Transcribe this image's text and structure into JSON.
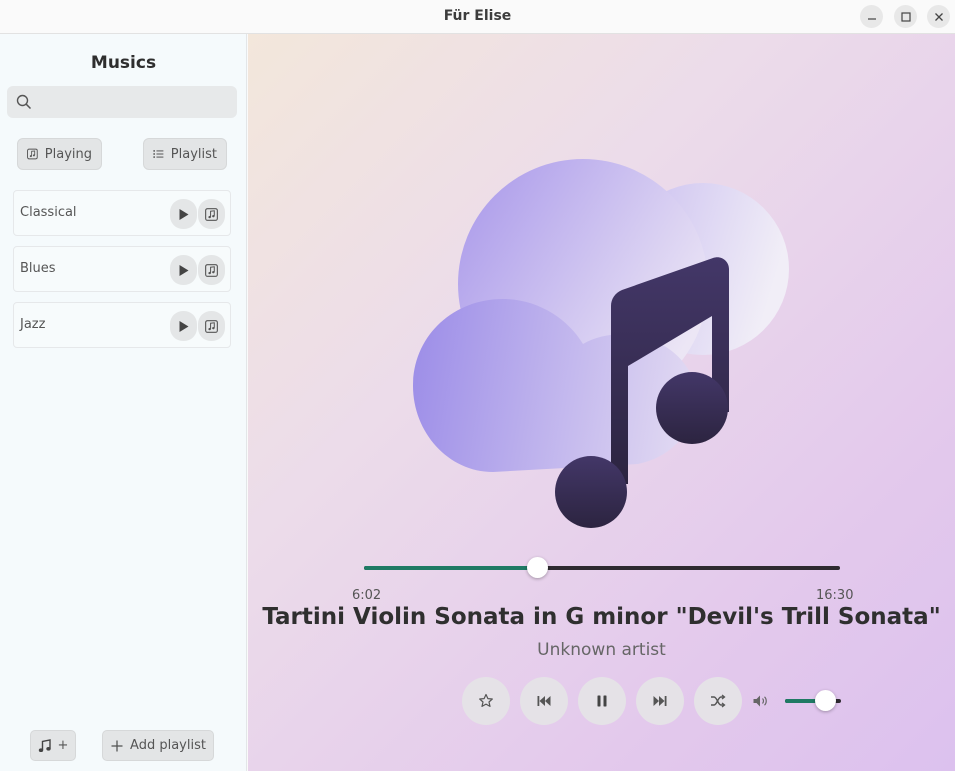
{
  "window": {
    "title": "Für Elise"
  },
  "sidebar": {
    "heading": "Musics",
    "search": {
      "placeholder": "",
      "value": ""
    },
    "tabs": [
      {
        "label": "Playing",
        "icon": "music-note-icon"
      },
      {
        "label": "Playlist",
        "icon": "list-icon"
      }
    ],
    "playlists": [
      {
        "label": "Classical"
      },
      {
        "label": "Blues"
      },
      {
        "label": "Jazz"
      }
    ],
    "footer": {
      "add_music_label": "+",
      "add_playlist_label": "Add playlist"
    }
  },
  "player": {
    "current_time": "6:02",
    "total_time": "16:30",
    "progress": 0.365,
    "volume": 0.72,
    "song_title": "Tartini Violin Sonata in G minor \"Devil's Trill Sonata\"",
    "artist": "Unknown artist"
  },
  "colors": {
    "accent": "#1f7a64",
    "note": "#3d3160",
    "cloud": "#b49ce8"
  }
}
